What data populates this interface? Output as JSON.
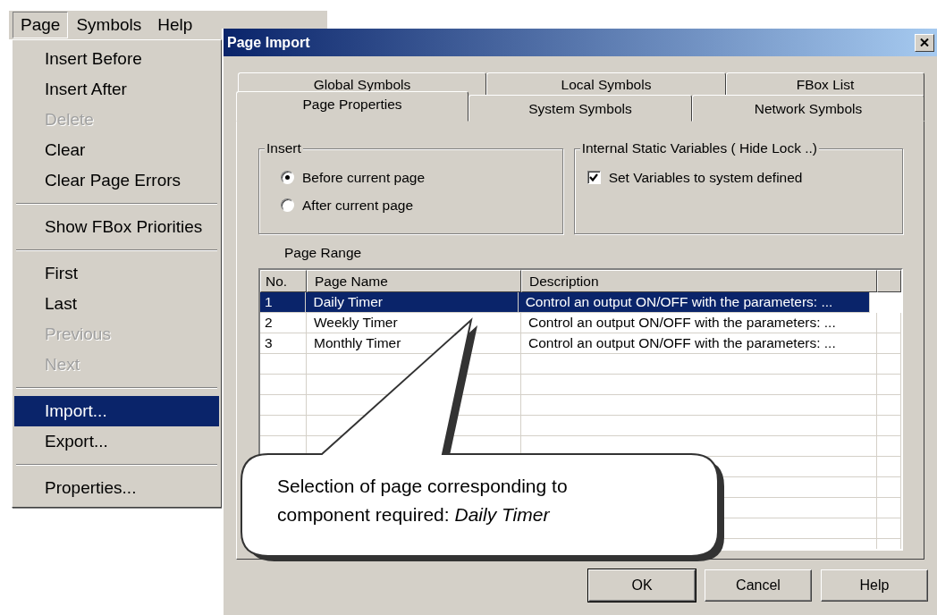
{
  "menu_bar": [
    {
      "label": "Page",
      "selected": true
    },
    {
      "label": "Symbols",
      "selected": false
    },
    {
      "label": "Help",
      "selected": false
    }
  ],
  "menu": [
    {
      "kind": "item",
      "label": "Insert Before",
      "disabled": false,
      "selected": false
    },
    {
      "kind": "item",
      "label": "Insert After",
      "disabled": false,
      "selected": false
    },
    {
      "kind": "item",
      "label": "Delete",
      "disabled": true,
      "selected": false
    },
    {
      "kind": "item",
      "label": "Clear",
      "disabled": false,
      "selected": false
    },
    {
      "kind": "item",
      "label": "Clear Page Errors",
      "disabled": false,
      "selected": false
    },
    {
      "kind": "separator"
    },
    {
      "kind": "item",
      "label": "Show FBox Priorities",
      "disabled": false,
      "selected": false
    },
    {
      "kind": "separator"
    },
    {
      "kind": "item",
      "label": "First",
      "disabled": false,
      "selected": false
    },
    {
      "kind": "item",
      "label": "Last",
      "disabled": false,
      "selected": false
    },
    {
      "kind": "item",
      "label": "Previous",
      "disabled": true,
      "selected": false
    },
    {
      "kind": "item",
      "label": "Next",
      "disabled": true,
      "selected": false
    },
    {
      "kind": "separator"
    },
    {
      "kind": "item",
      "label": "Import...",
      "disabled": false,
      "selected": true
    },
    {
      "kind": "item",
      "label": "Export...",
      "disabled": false,
      "selected": false
    },
    {
      "kind": "separator"
    },
    {
      "kind": "item",
      "label": "Properties...",
      "disabled": false,
      "selected": false
    }
  ],
  "dialog": {
    "title": "Page Import",
    "tab_rows": [
      [
        {
          "label": "Global Symbols",
          "selected": false
        },
        {
          "label": "Local Symbols",
          "selected": false
        },
        {
          "label": "FBox List",
          "selected": false
        }
      ],
      [
        {
          "label": "Page Properties",
          "selected": true
        },
        {
          "label": "System Symbols",
          "selected": false
        },
        {
          "label": "Network Symbols",
          "selected": false
        }
      ]
    ],
    "insert_group": {
      "title": "Insert",
      "options": [
        {
          "label": "Before current page",
          "selected": true
        },
        {
          "label": "After current page",
          "selected": false
        }
      ]
    },
    "static_group": {
      "title": "Internal Static Variables ( Hide Lock ..)",
      "checkbox": {
        "label": "Set Variables to system defined",
        "checked": true
      }
    },
    "page_range": {
      "label": "Page Range",
      "columns": [
        "No.",
        "Page Name",
        "Description"
      ],
      "rows": [
        {
          "cells": [
            "1",
            "Daily Timer",
            "Control an output ON/OFF with the parameters:  ..."
          ],
          "selected": true
        },
        {
          "cells": [
            "2",
            "Weekly Timer",
            "Control an output ON/OFF with the parameters:  ..."
          ],
          "selected": false
        },
        {
          "cells": [
            "3",
            "Monthly Timer",
            "Control an output ON/OFF with the parameters:  ..."
          ],
          "selected": false
        }
      ]
    },
    "buttons": [
      {
        "label": "OK",
        "default": true
      },
      {
        "label": "Cancel",
        "default": false
      },
      {
        "label": "Help",
        "default": false
      }
    ]
  },
  "callout": {
    "text": "Selection of page corresponding to component required: *Daily Timer*"
  }
}
